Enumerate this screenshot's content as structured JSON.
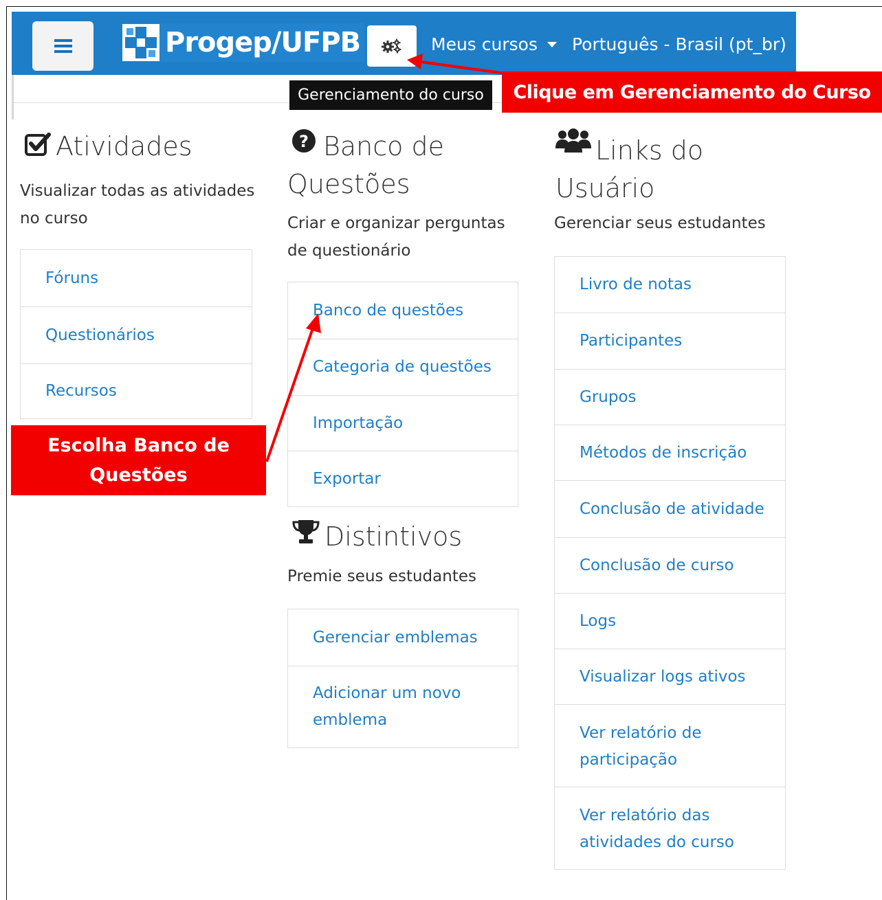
{
  "navbar": {
    "brand": "Progep/UFPB",
    "my_courses": "Meus cursos",
    "language": "Português - Brasil (pt_br)"
  },
  "tooltip": "Gerenciamento do curso",
  "callouts": {
    "manage_course": "Clique em Gerenciamento do Curso",
    "choose_bank_line1": "Escolha Banco de",
    "choose_bank_line2": "Questões"
  },
  "activities": {
    "title": "Atividades",
    "description_line1": "Visualizar todas as atividades",
    "description_line2": "no curso",
    "items": [
      "Fóruns",
      "Questionários",
      "Recursos"
    ]
  },
  "question_bank": {
    "title_line1": "Banco de",
    "title_line2": "Questões",
    "description_line1": "Criar e organizar perguntas",
    "description_line2": "de questionário",
    "items": [
      "Banco de questões",
      "Categoria de questões",
      "Importação",
      "Exportar"
    ]
  },
  "badges": {
    "title": "Distintivos",
    "description": "Premie seus estudantes",
    "item1": "Gerenciar emblemas",
    "item2_line1": "Adicionar um novo",
    "item2_line2": "emblema"
  },
  "user_links": {
    "title_line1": "Links do",
    "title_line2": "Usuário",
    "description": "Gerenciar seus estudantes",
    "items": [
      "Livro de notas",
      "Participantes",
      "Grupos",
      "Métodos de inscrição",
      "Conclusão de atividade",
      "Conclusão de curso",
      "Logs",
      "Visualizar logs ativos"
    ],
    "item9_line1": "Ver relatório de",
    "item9_line2": "participação",
    "item10_line1": "Ver relatório das",
    "item10_line2": "atividades do curso"
  },
  "colors": {
    "navbar": "#1e7ec8",
    "link": "#1f7fc7",
    "callout": "#f20000",
    "tooltip": "#111111"
  }
}
